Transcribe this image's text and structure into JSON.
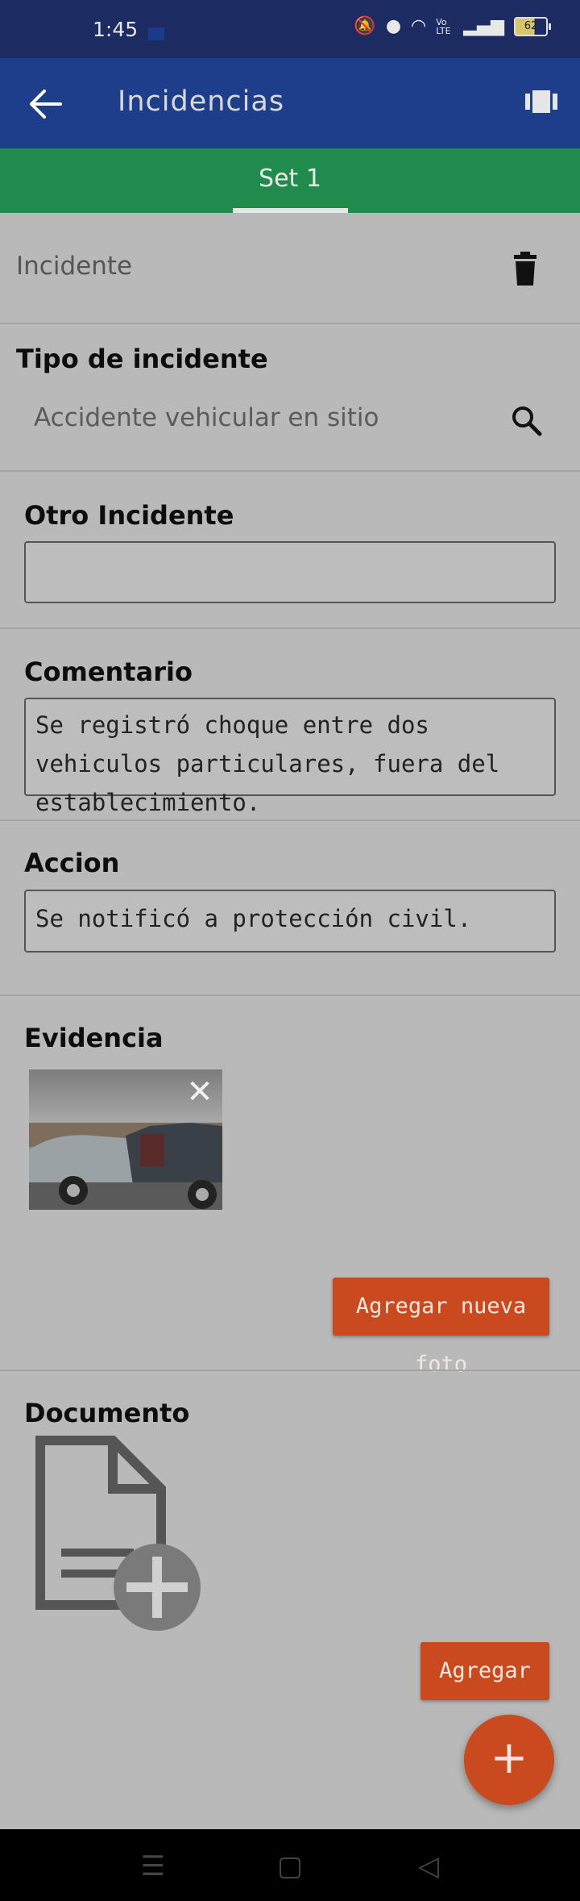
{
  "status_bar": {
    "time": "1:45",
    "battery": "62",
    "signal_label": "Vo LTE"
  },
  "app_bar": {
    "title": "Incidencias",
    "back_icon": "arrow-left-icon",
    "view_icon": "carousel-view-icon"
  },
  "tabs": [
    {
      "label": "Set 1",
      "active": true
    }
  ],
  "form": {
    "section_title": "Incidente",
    "tipo_label": "Tipo de incidente",
    "tipo_value": "Accidente vehicular en sitio",
    "otro_label": "Otro Incidente",
    "otro_value": "",
    "comentario_label": "Comentario",
    "comentario_value": "Se registró choque entre dos vehiculos particulares, fuera del establecimiento.",
    "accion_label": "Accion",
    "accion_value": "Se notificó a protección civil.",
    "evidencia_label": "Evidencia",
    "add_photo_label": "Agregar nueva foto",
    "documento_label": "Documento",
    "agregar_label": "Agregar"
  },
  "fab": {
    "label": "+"
  },
  "colors": {
    "status_bar": "#1c2c63",
    "app_bar": "#1e3e8c",
    "tab_bar": "#218b4b",
    "accent_orange": "#c84a1e",
    "background": "#b9b9b9"
  }
}
